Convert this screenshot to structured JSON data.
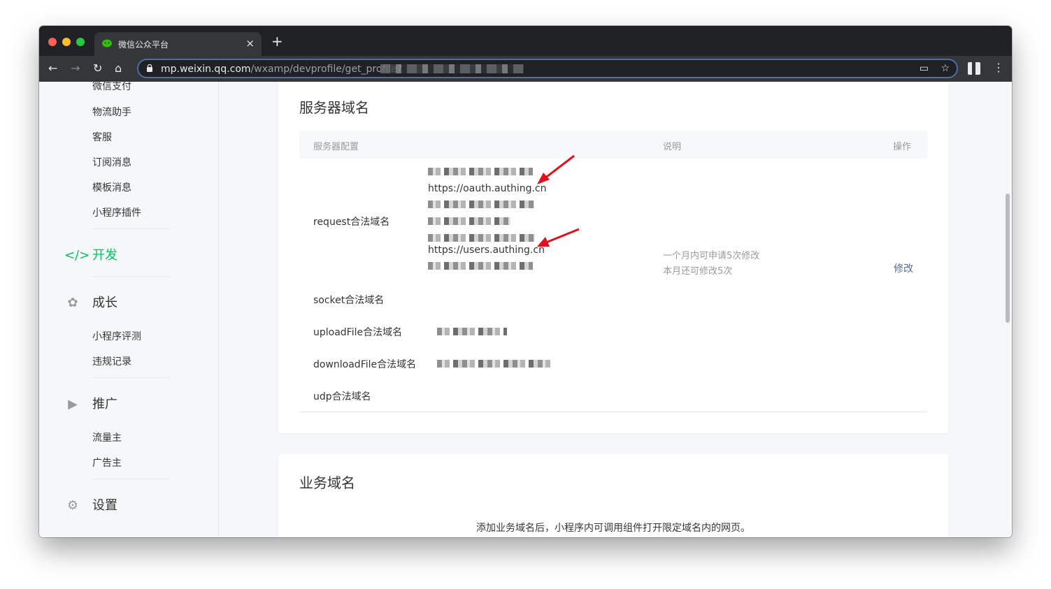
{
  "browser": {
    "tab_title": "微信公众平台",
    "tab_close": "×",
    "new_tab": "+",
    "url_host": "mp.weixin.qq.com",
    "url_path": "/wxamp/devprofile/get_profile?",
    "icons": [
      "back-icon",
      "forward-icon",
      "reload-icon",
      "home-icon",
      "lock-icon",
      "cast-icon",
      "star-icon",
      "menu-icon"
    ]
  },
  "sidebar": {
    "top_items": [
      "微信支付",
      "物流助手",
      "客服",
      "订阅消息",
      "模板消息",
      "小程序插件"
    ],
    "sections": [
      {
        "label": "开发",
        "icon": "code-icon",
        "active": true
      },
      {
        "label": "成长",
        "icon": "sprout-icon",
        "active": false,
        "items": [
          "小程序评测",
          "违规记录"
        ]
      },
      {
        "label": "推广",
        "icon": "megaphone-icon",
        "active": false,
        "items": [
          "流量主",
          "广告主"
        ]
      },
      {
        "label": "设置",
        "icon": "gear-icon",
        "active": false
      }
    ]
  },
  "server_domains": {
    "title": "服务器域名",
    "headers": {
      "config": "服务器配置",
      "description": "说明",
      "action": "操作"
    },
    "rows": {
      "request": "request合法域名",
      "socket": "socket合法域名",
      "upload": "uploadFile合法域名",
      "download": "downloadFile合法域名",
      "udp": "udp合法域名"
    },
    "request_domains": [
      "https://oauth.authing.cn",
      "https://users.authing.cn"
    ],
    "note_line1": "一个月内可申请5次修改",
    "note_line2": "本月还可修改5次",
    "modify_label": "修改",
    "annotation_color": "#e0101e"
  },
  "business_domains": {
    "title": "业务域名",
    "description": "添加业务域名后，小程序内可调用组件打开限定域名内的网页。"
  },
  "colors": {
    "active": "#07c160",
    "link": "#576b95",
    "text": "#353535",
    "muted": "#9a9a9a"
  }
}
